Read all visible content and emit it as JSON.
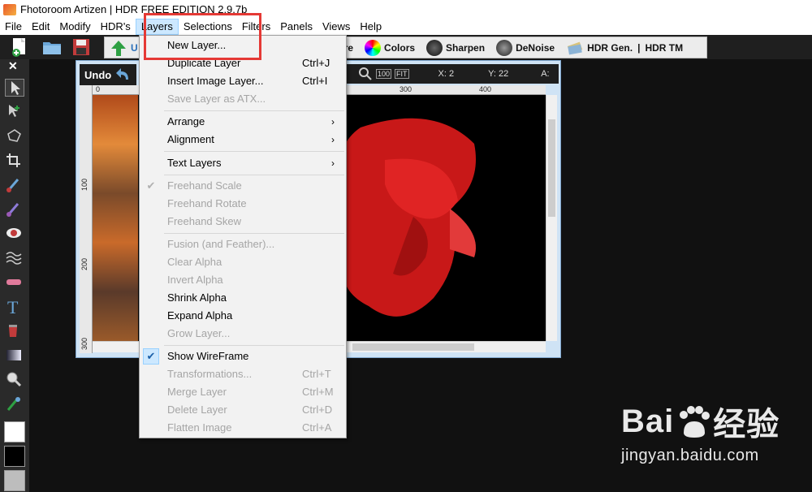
{
  "window": {
    "title": "Fhotoroom Artizen | HDR FREE EDITION 2.9.7b"
  },
  "menubar": [
    "File",
    "Edit",
    "Modify",
    "HDR's",
    "Layers",
    "Selections",
    "Filters",
    "Panels",
    "Views",
    "Help"
  ],
  "toolbar": {
    "partial_left": "U",
    "measure": "sure",
    "colors": "Colors",
    "sharpen": "Sharpen",
    "denoise": "DeNoise",
    "hdr_gen": "HDR Gen.",
    "separator": "|",
    "hdr_tm": "HDR TM"
  },
  "panel_close": "✕",
  "document": {
    "undo_label": "Undo",
    "zoom_100": "100",
    "zoom_fit": "FIT",
    "x_readout": "X: 2",
    "y_readout": "Y: 22",
    "a_readout": "A:",
    "ruler_top": [
      "0",
      "300",
      "400"
    ],
    "ruler_left": [
      "100",
      "200",
      "300"
    ]
  },
  "layers_menu": {
    "items": [
      {
        "label": "New Layer...",
        "shortcut": "",
        "enabled": true
      },
      {
        "label": "Duplicate Layer",
        "shortcut": "Ctrl+J",
        "enabled": true
      },
      {
        "label": "Insert Image Layer...",
        "shortcut": "Ctrl+I",
        "enabled": true
      },
      {
        "label": "Save Layer as ATX...",
        "shortcut": "",
        "enabled": false
      },
      {
        "label": "Arrange",
        "submenu": true,
        "enabled": true
      },
      {
        "label": "Alignment",
        "submenu": true,
        "enabled": true
      },
      {
        "label": "Text Layers",
        "submenu": true,
        "enabled": true
      },
      {
        "label": "Freehand Scale",
        "checked": true,
        "enabled": false
      },
      {
        "label": "Freehand Rotate",
        "enabled": false
      },
      {
        "label": "Freehand Skew",
        "enabled": false
      },
      {
        "label": "Fusion (and Feather)...",
        "enabled": false
      },
      {
        "label": "Clear Alpha",
        "enabled": false
      },
      {
        "label": "Invert Alpha",
        "enabled": false
      },
      {
        "label": "Shrink Alpha",
        "enabled": true
      },
      {
        "label": "Expand Alpha",
        "enabled": true
      },
      {
        "label": "Grow Layer...",
        "enabled": false
      },
      {
        "label": "Show WireFrame",
        "checked": true,
        "enabled": true
      },
      {
        "label": "Transformations...",
        "shortcut": "Ctrl+T",
        "enabled": false
      },
      {
        "label": "Merge Layer",
        "shortcut": "Ctrl+M",
        "enabled": false
      },
      {
        "label": "Delete Layer",
        "shortcut": "Ctrl+D",
        "enabled": false
      },
      {
        "label": "Flatten Image",
        "shortcut": "Ctrl+A",
        "enabled": false
      }
    ]
  },
  "watermark": {
    "brand_latin": "Bai",
    "brand_cn": "经验",
    "url": "jingyan.baidu.com"
  },
  "colors": {
    "highlight_box": "#e53935",
    "menu_bg": "#f2f2f2",
    "fish_red": "#d81c1c"
  }
}
